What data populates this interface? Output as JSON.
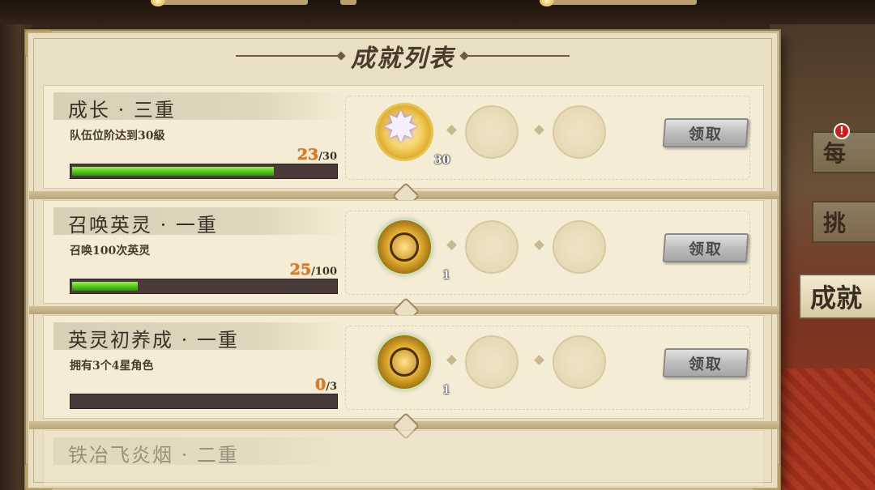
{
  "panel": {
    "title": "成就列表"
  },
  "achievements": [
    {
      "name": "成长 · 三重",
      "description": "队伍位阶达到30級",
      "progress_current": "23",
      "progress_total": "/30",
      "progress_fraction": 0.767,
      "reward_icon": "crystal-star-icon",
      "reward_qty": "30",
      "claim_label": "领取"
    },
    {
      "name": "召唤英灵 · 一重",
      "description": "召唤100次英灵",
      "progress_current": "25",
      "progress_total": "/100",
      "progress_fraction": 0.25,
      "reward_icon": "gold-coin-icon",
      "reward_qty": "1",
      "claim_label": "领取"
    },
    {
      "name": "英灵初养成 · 一重",
      "description": "拥有3个4星角色",
      "progress_current": "0",
      "progress_total": "/3",
      "progress_fraction": 0,
      "reward_icon": "gold-coin-icon",
      "reward_qty": "1",
      "claim_label": "领取"
    },
    {
      "name": "铁冶飞炎烟 · 二重"
    }
  ],
  "side_tabs": [
    {
      "label": "每",
      "badge": "!"
    },
    {
      "label": "挑"
    },
    {
      "label": "成就"
    }
  ],
  "colors": {
    "progress_green": "#4cc21a",
    "progress_number": "#e07a18",
    "parchment": "#f4ecd4"
  }
}
